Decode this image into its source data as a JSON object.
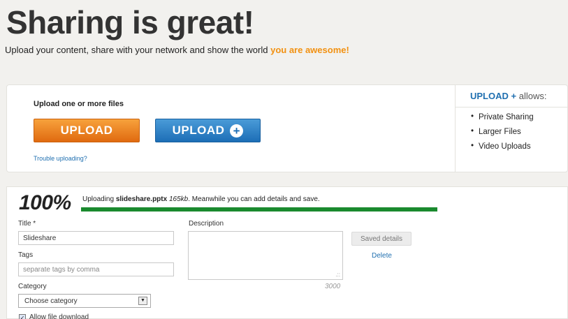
{
  "header": {
    "title": "Sharing is great!",
    "subtitle": "Upload your content, share with your network and show the world ",
    "subtitle_highlight": "you are awesome!"
  },
  "upload": {
    "label": "Upload one or more files",
    "upload_button": "UPLOAD",
    "upload_plus_button": "UPLOAD",
    "trouble_link": "Trouble uploading?"
  },
  "allows": {
    "brand": "UPLOAD",
    "plus": "+",
    "suffix": " allows:",
    "items": [
      "Private Sharing",
      "Larger Files",
      "Video Uploads"
    ]
  },
  "progress": {
    "percent_text": "100%",
    "value": 1.0,
    "message_prefix": "Uploading ",
    "filename": "slideshare.pptx",
    "filesize": "165kb",
    "message_suffix": ". Meanwhile you can add details and save.",
    "color": "#1a8a2e"
  },
  "form": {
    "title_label": "Title *",
    "title_value": "Slideshare",
    "tags_label": "Tags",
    "tags_placeholder": "separate tags by comma",
    "category_label": "Category",
    "category_value": "Choose category",
    "description_label": "Description",
    "char_counter": "3000",
    "saved_button": "Saved details",
    "delete_link": "Delete",
    "allow_download_label": "Allow file download",
    "allow_download_checked": true
  },
  "colors": {
    "accent_orange": "#f29111",
    "upload_orange": "#e06a10",
    "upload_blue": "#1d6eb6",
    "link_blue": "#1f6fb0"
  }
}
